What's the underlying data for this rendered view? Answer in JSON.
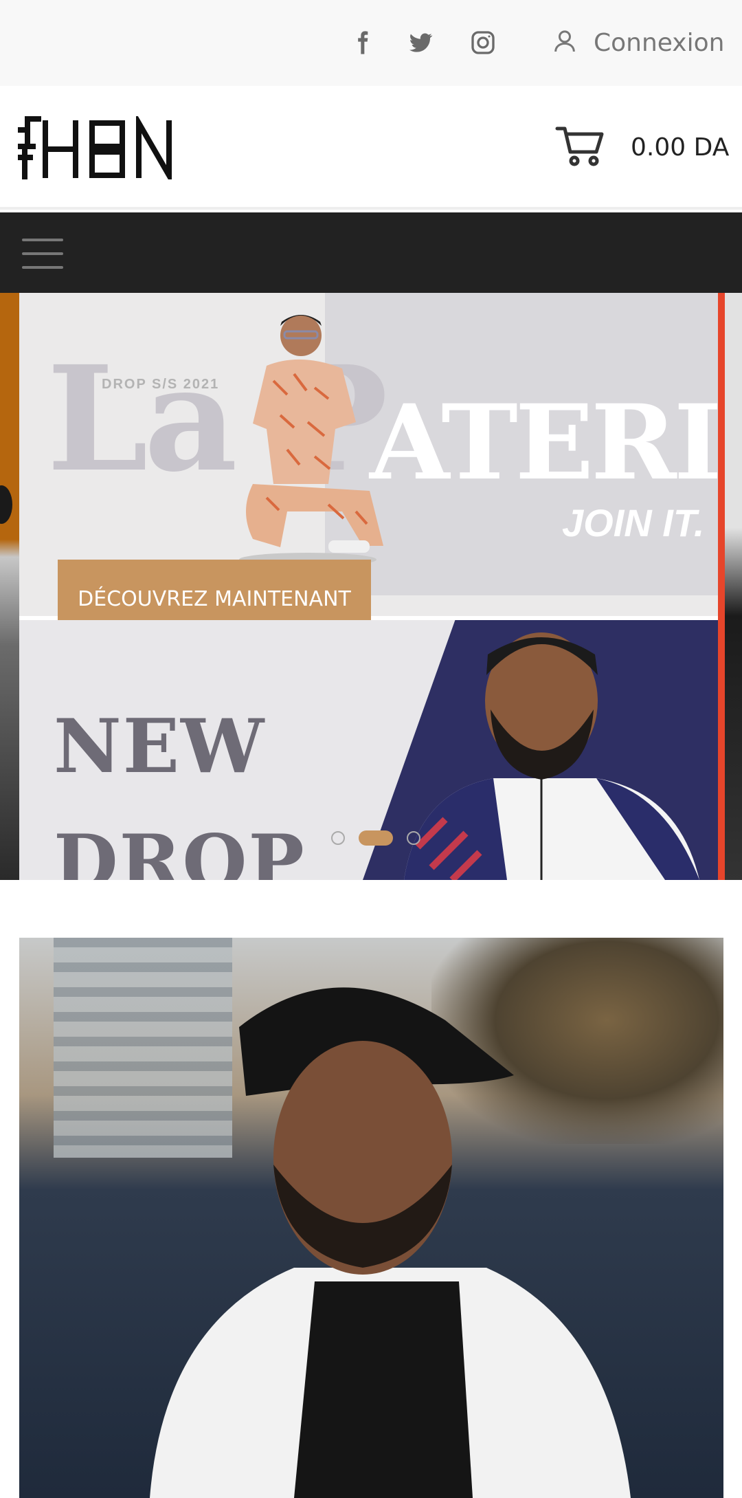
{
  "topbar": {
    "social": [
      {
        "name": "facebook",
        "icon": "facebook-icon"
      },
      {
        "name": "twitter",
        "icon": "twitter-icon"
      },
      {
        "name": "instagram",
        "icon": "instagram-icon"
      }
    ],
    "login_label": "Connexion"
  },
  "header": {
    "logo_text": "HBN",
    "cart_total": "0.00 DA"
  },
  "hero": {
    "drop_label": "DROP S/S 2021",
    "title_left": "La P",
    "title_right": "ATERIE",
    "tagline": "JOIN IT.",
    "cta_label": "DÉCOUVREZ MAINTENANT",
    "new_drop": [
      "NEW",
      "DROP"
    ],
    "slides_count": 3,
    "active_slide": 2
  },
  "colors": {
    "accent": "#c8955f",
    "nav_bg": "#222222",
    "topbar_bg": "#f8f8f8"
  }
}
